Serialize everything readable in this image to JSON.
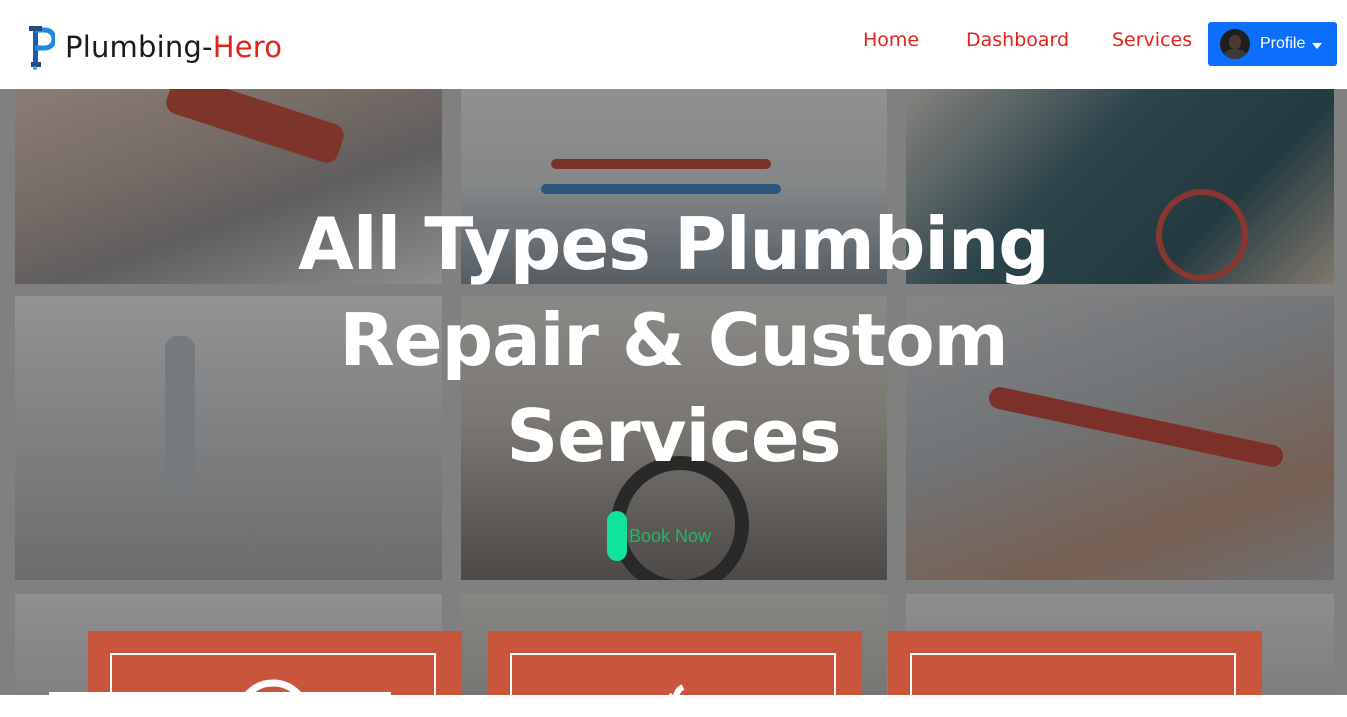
{
  "navbar": {
    "brand_prefix": "Plumbing-",
    "brand_accent": "Hero",
    "links": [
      {
        "label": "Home"
      },
      {
        "label": "Dashboard"
      },
      {
        "label": "Services"
      }
    ],
    "profile": {
      "label": "Profile"
    }
  },
  "hero": {
    "title_lines": [
      "All Types Plumbing",
      "Repair & Custom",
      "Services"
    ],
    "cta_label": "Book Now"
  },
  "cards": [
    {
      "icon": "gear-icon"
    },
    {
      "icon": "wrench-icon"
    },
    {
      "icon": "cog-icon"
    }
  ],
  "colors": {
    "accent_red": "#e0231d",
    "profile_blue": "#0d6efd",
    "cta_green": "#12e39a",
    "card_orange": "#c8553c"
  }
}
